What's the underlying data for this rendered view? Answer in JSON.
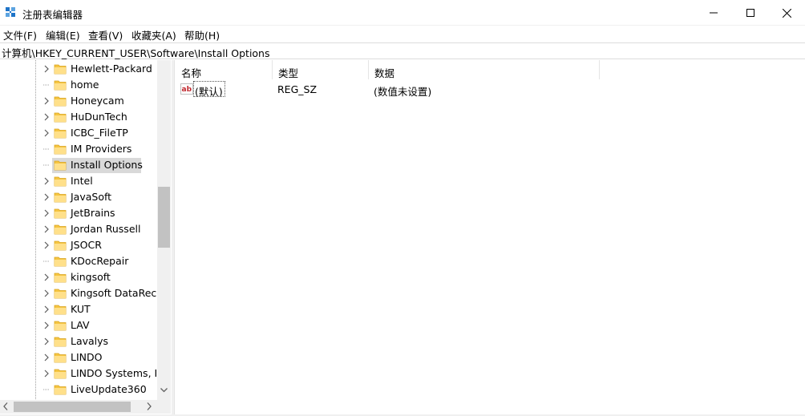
{
  "window": {
    "title": "注册表编辑器",
    "minimize_label": "minimize",
    "maximize_label": "maximize",
    "close_label": "close"
  },
  "menu": [
    "文件(F)",
    "编辑(E)",
    "查看(V)",
    "收藏夹(A)",
    "帮助(H)"
  ],
  "address": "计算机\\HKEY_CURRENT_USER\\Software\\Install Options",
  "tree": {
    "selected": "Install Options",
    "items": [
      {
        "label": "Hewlett-Packard",
        "expandable": true
      },
      {
        "label": "home",
        "expandable": false
      },
      {
        "label": "Honeycam",
        "expandable": true
      },
      {
        "label": "HuDunTech",
        "expandable": true
      },
      {
        "label": "ICBC_FileTP",
        "expandable": true
      },
      {
        "label": "IM Providers",
        "expandable": false
      },
      {
        "label": "Install Options",
        "expandable": false
      },
      {
        "label": "Intel",
        "expandable": true
      },
      {
        "label": "JavaSoft",
        "expandable": true
      },
      {
        "label": "JetBrains",
        "expandable": true
      },
      {
        "label": "Jordan Russell",
        "expandable": true
      },
      {
        "label": "JSOCR",
        "expandable": true
      },
      {
        "label": "KDocRepair",
        "expandable": false
      },
      {
        "label": "kingsoft",
        "expandable": true
      },
      {
        "label": "Kingsoft DataReco",
        "expandable": true
      },
      {
        "label": "KUT",
        "expandable": true
      },
      {
        "label": "LAV",
        "expandable": true
      },
      {
        "label": "Lavalys",
        "expandable": true
      },
      {
        "label": "LINDO",
        "expandable": true
      },
      {
        "label": "LINDO Systems, In",
        "expandable": true
      },
      {
        "label": "LiveUpdate360",
        "expandable": false
      }
    ]
  },
  "list": {
    "columns": [
      "名称",
      "类型",
      "数据"
    ],
    "rows": [
      {
        "icon": "string-value-icon",
        "name": "(默认)",
        "type": "REG_SZ",
        "data": "(数值未设置)"
      }
    ]
  },
  "colors": {
    "selected_bg": "#d9d9d9",
    "folder": "#f5c542",
    "scrollbar_thumb": "#c2c2c2"
  }
}
